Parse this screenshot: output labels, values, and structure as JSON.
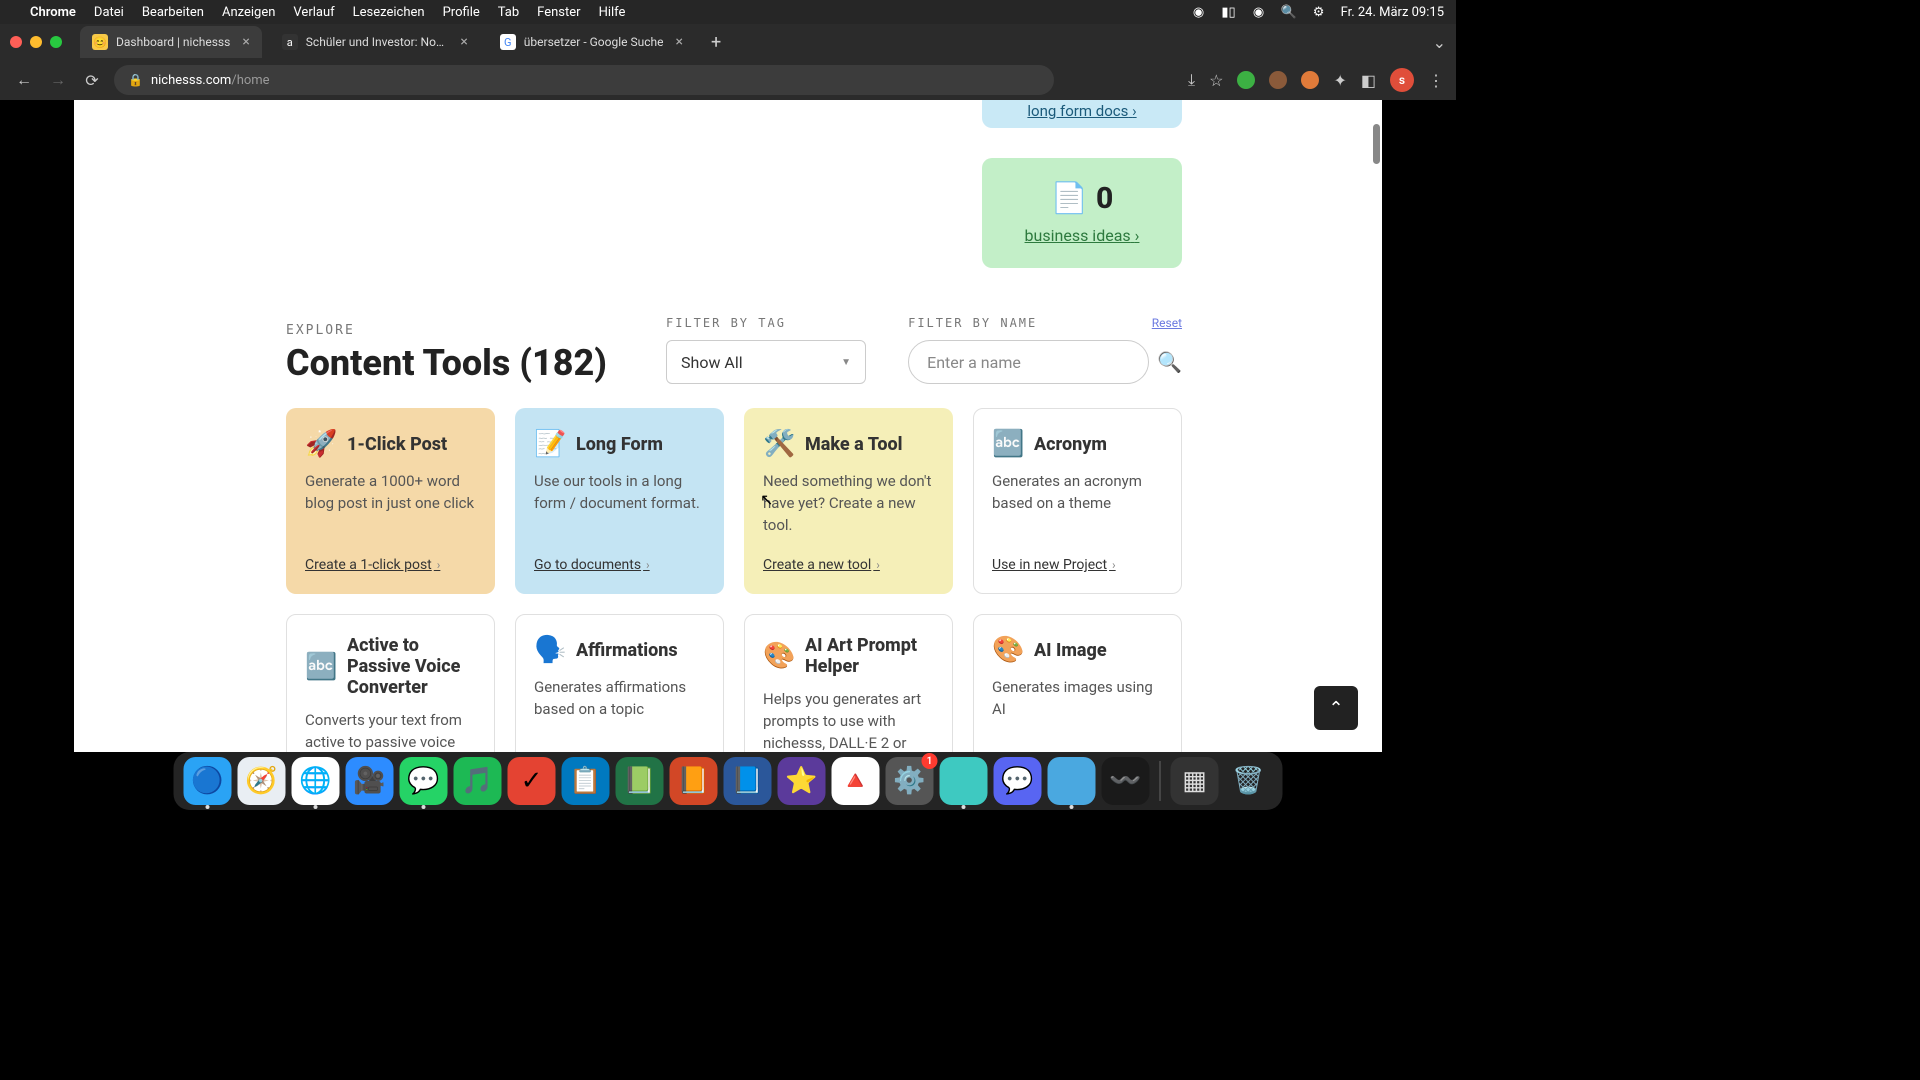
{
  "menubar": {
    "app": "Chrome",
    "items": [
      "Datei",
      "Bearbeiten",
      "Anzeigen",
      "Verlauf",
      "Lesezeichen",
      "Profile",
      "Tab",
      "Fenster",
      "Hilfe"
    ],
    "datetime": "Fr. 24. März 09:15"
  },
  "tabs": [
    {
      "title": "Dashboard | nichesss",
      "favicon_bg": "#f7c948",
      "favicon_txt": "😊"
    },
    {
      "title": "Schüler und Investor: Noah au",
      "favicon_bg": "#333",
      "favicon_txt": "a"
    },
    {
      "title": "übersetzer - Google Suche",
      "favicon_bg": "#fff",
      "favicon_txt": "G"
    }
  ],
  "address": {
    "domain": "nichesss.com",
    "path": "/home"
  },
  "profile_initial": "s",
  "top_cards": {
    "blue_link": "long form docs",
    "green_count": "0",
    "green_link": "business ideas"
  },
  "explore": {
    "eyebrow": "EXPLORE",
    "title": "Content Tools (182)"
  },
  "filters": {
    "tag_label": "FILTER BY TAG",
    "tag_value": "Show All",
    "name_label": "FILTER BY NAME",
    "name_placeholder": "Enter a name",
    "reset": "Reset"
  },
  "tools": [
    {
      "icon": "🚀",
      "title": "1-Click Post",
      "desc": "Generate a 1000+ word blog post in just one click",
      "link": "Create a 1-click post",
      "variant": "orange"
    },
    {
      "icon": "📝",
      "title": "Long Form",
      "desc": "Use our tools in a long form / document format.",
      "link": "Go to documents",
      "variant": "blue"
    },
    {
      "icon": "🛠️",
      "title": "Make a Tool",
      "desc": "Need something we don't have yet? Create a new tool.",
      "link": "Create a new tool",
      "variant": "yellow"
    },
    {
      "icon": "🔤",
      "title": "Acronym",
      "desc": "Generates an acronym based on a theme",
      "link": "Use in new Project",
      "variant": "white"
    },
    {
      "icon": "🔤",
      "title": "Active to Passive Voice Converter",
      "desc": "Converts your text from active to passive voice and vice-versa",
      "link": "",
      "variant": "white"
    },
    {
      "icon": "🗣️",
      "title": "Affirmations",
      "desc": "Generates affirmations based on a topic",
      "link": "",
      "variant": "white"
    },
    {
      "icon": "🎨",
      "title": "AI Art Prompt Helper",
      "desc": "Helps you generates art prompts to use with nichesss, DALL·E 2 or",
      "link": "",
      "variant": "white"
    },
    {
      "icon": "🎨",
      "title": "AI Image",
      "desc": "Generates images using AI",
      "link": "",
      "variant": "white"
    }
  ],
  "dock": {
    "items": [
      {
        "name": "finder",
        "emoji": "🔵",
        "bg": "#2aa3f5",
        "running": true
      },
      {
        "name": "safari",
        "emoji": "🧭",
        "bg": "#e9eef3",
        "running": false
      },
      {
        "name": "chrome",
        "emoji": "🌐",
        "bg": "#fff",
        "running": true
      },
      {
        "name": "zoom",
        "emoji": "🎥",
        "bg": "#2d8cff",
        "running": false
      },
      {
        "name": "whatsapp",
        "emoji": "💬",
        "bg": "#25d366",
        "running": true
      },
      {
        "name": "spotify",
        "emoji": "🎵",
        "bg": "#1db954",
        "running": false
      },
      {
        "name": "todoist",
        "emoji": "✓",
        "bg": "#e44332",
        "running": false
      },
      {
        "name": "trello",
        "emoji": "📋",
        "bg": "#0079bf",
        "running": false
      },
      {
        "name": "excel",
        "emoji": "📗",
        "bg": "#217346",
        "running": false
      },
      {
        "name": "powerpoint",
        "emoji": "📙",
        "bg": "#d24726",
        "running": false
      },
      {
        "name": "word",
        "emoji": "📘",
        "bg": "#2b579a",
        "running": false
      },
      {
        "name": "imovie",
        "emoji": "⭐",
        "bg": "#5b3a9b",
        "running": false
      },
      {
        "name": "drive",
        "emoji": "🔺",
        "bg": "#fff",
        "running": false
      },
      {
        "name": "settings",
        "emoji": "⚙️",
        "bg": "#555",
        "running": false,
        "badge": "1"
      },
      {
        "name": "app-teal",
        "emoji": "",
        "bg": "#3ec9c1",
        "running": true
      },
      {
        "name": "discord",
        "emoji": "💬",
        "bg": "#5865f2",
        "running": false
      },
      {
        "name": "app-blue",
        "emoji": "",
        "bg": "#4aa8e0",
        "running": true
      },
      {
        "name": "voice-memos",
        "emoji": "〰️",
        "bg": "#1a1a1a",
        "running": false
      }
    ],
    "right": [
      {
        "name": "launchpad",
        "emoji": "▦",
        "bg": "#333"
      },
      {
        "name": "trash",
        "emoji": "🗑️",
        "bg": "transparent"
      }
    ]
  }
}
